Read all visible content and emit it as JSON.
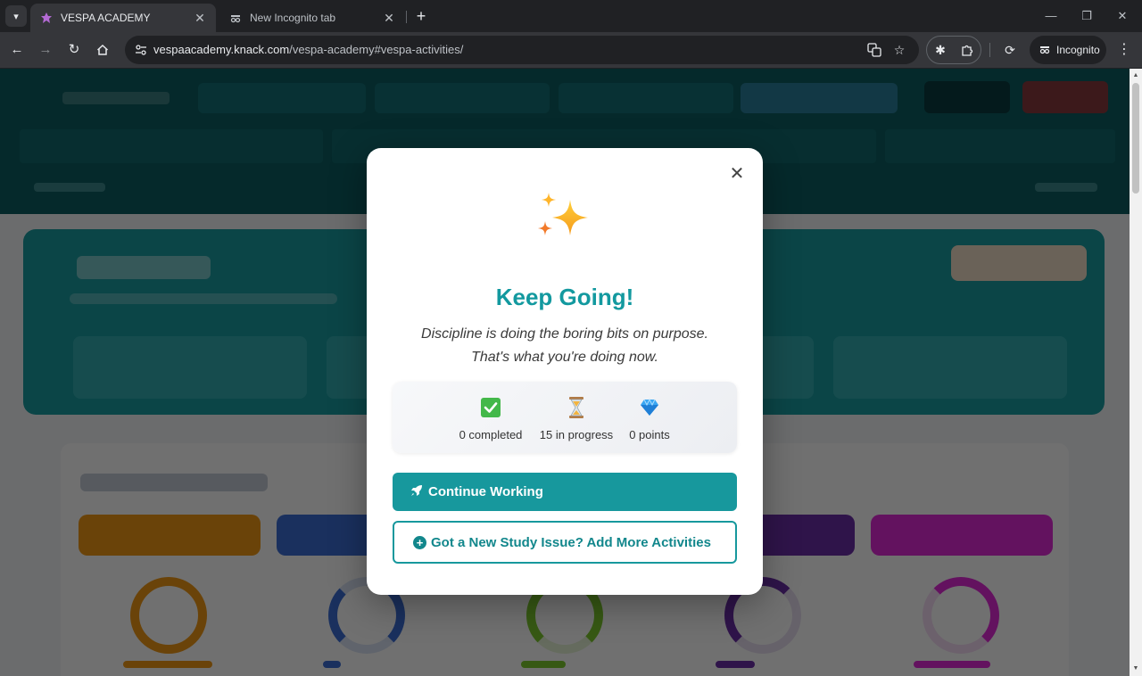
{
  "browser": {
    "tabs": [
      {
        "title": "VESPA ACADEMY",
        "active": true
      },
      {
        "title": "New Incognito tab",
        "active": false
      }
    ],
    "url_host": "vespaacademy.knack.com",
    "url_path": "/vespa-academy#vespa-activities/",
    "profile_label": "Incognito"
  },
  "modal": {
    "title": "Keep Going!",
    "quote_line1": "Discipline is doing the boring bits on purpose.",
    "quote_line2": "That's what you're doing now.",
    "stats": [
      {
        "icon": "check-icon",
        "label": "0 completed"
      },
      {
        "icon": "hourglass-icon",
        "label": "15 in progress"
      },
      {
        "icon": "gem-icon",
        "label": "0 points"
      }
    ],
    "primary_button": "Continue Working",
    "secondary_button": "Got a New Study Issue? Add More Activities"
  },
  "colors": {
    "accent": "#17989d",
    "title": "#13999f",
    "page_header": "#0d5f62",
    "hero": "#1a9ea2"
  }
}
